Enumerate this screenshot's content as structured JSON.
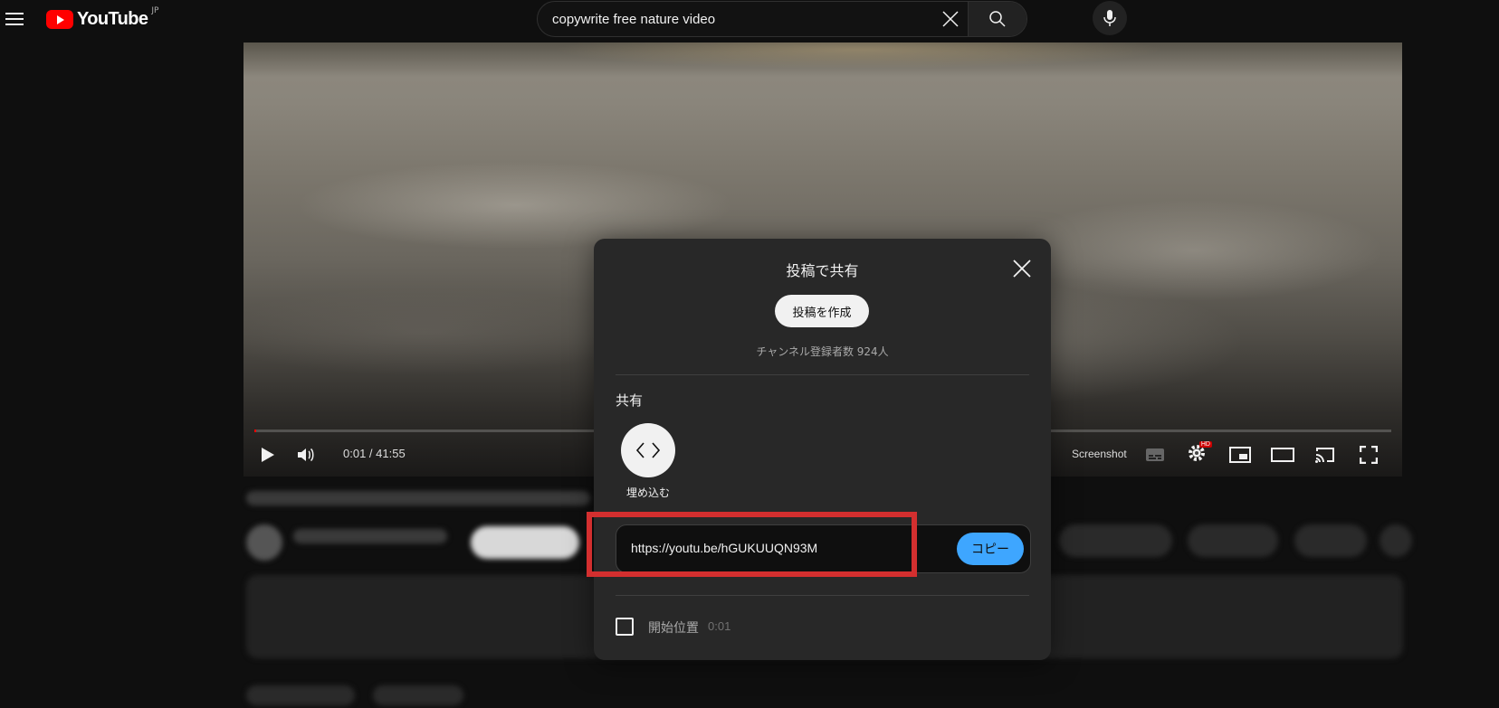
{
  "header": {
    "logo_text": "YouTube",
    "region": "JP",
    "search_value": "copywrite free nature video"
  },
  "player": {
    "time": "0:01 / 41:55",
    "screenshot_label": "Screenshot",
    "hd_badge": "HD",
    "progress": 0.0004
  },
  "share_dialog": {
    "title": "投稿で共有",
    "post_button": "投稿を作成",
    "subscribers": "チャンネル登録者数 924人",
    "share_heading": "共有",
    "embed_label": "埋め込む",
    "url": "https://youtu.be/hGUKUUQN93M",
    "copy_button": "コピー",
    "start_at_label": "開始位置",
    "start_at_time": "0:01"
  },
  "colors": {
    "accent_blue": "#3ea6ff",
    "brand_red": "#ff0000",
    "highlight_red": "#d32f2f",
    "background": "#0f0f0f",
    "dialog_bg": "#282828"
  }
}
